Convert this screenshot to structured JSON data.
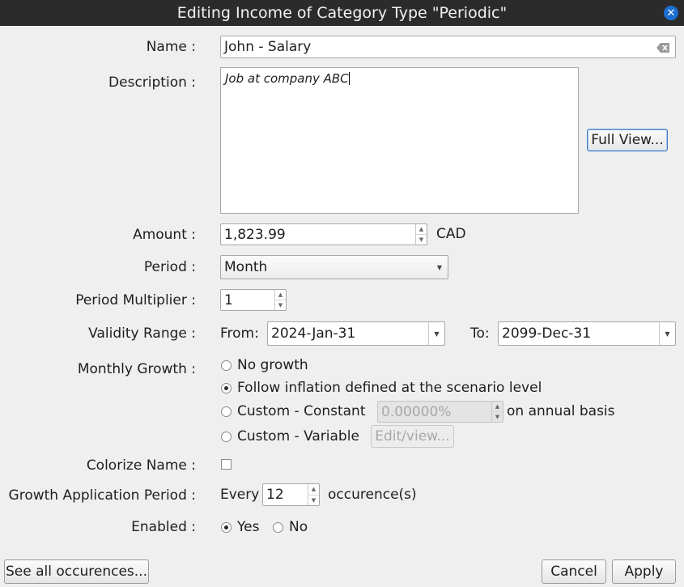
{
  "window": {
    "title": "Editing Income of Category Type \"Periodic\"",
    "close_icon": "close-icon"
  },
  "labels": {
    "name": "Name :",
    "description": "Description :",
    "amount": "Amount :",
    "period": "Period :",
    "period_multiplier": "Period Multiplier :",
    "validity_range": "Validity Range :",
    "monthly_growth": "Monthly Growth :",
    "colorize_name": "Colorize Name :",
    "growth_application_period": "Growth Application Period :",
    "enabled": "Enabled :"
  },
  "name": {
    "value": "John - Salary"
  },
  "description": {
    "value": "Job at company ABC",
    "full_view_button": "Full View..."
  },
  "amount": {
    "value": "1,823.99",
    "currency": "CAD"
  },
  "period": {
    "selected": "Month"
  },
  "period_multiplier": {
    "value": "1"
  },
  "validity": {
    "from_label": "From:",
    "from_value": "2024-Jan-31",
    "to_label": "To:",
    "to_value": "2099-Dec-31"
  },
  "growth": {
    "options": {
      "none": "No growth",
      "inflation": "Follow inflation defined at the scenario level",
      "constant": "Custom - Constant",
      "variable": "Custom - Variable"
    },
    "selected": "inflation",
    "constant_value": "0.00000%",
    "annual_basis_label": "on annual basis",
    "edit_view_button": "Edit/view..."
  },
  "colorize_name": {
    "checked": false
  },
  "growth_application": {
    "every_label": "Every",
    "value": "12",
    "suffix": "occurence(s)"
  },
  "enabled": {
    "yes": "Yes",
    "no": "No",
    "selected": "yes"
  },
  "footer": {
    "see_all": "See all occurences...",
    "cancel": "Cancel",
    "apply": "Apply"
  }
}
